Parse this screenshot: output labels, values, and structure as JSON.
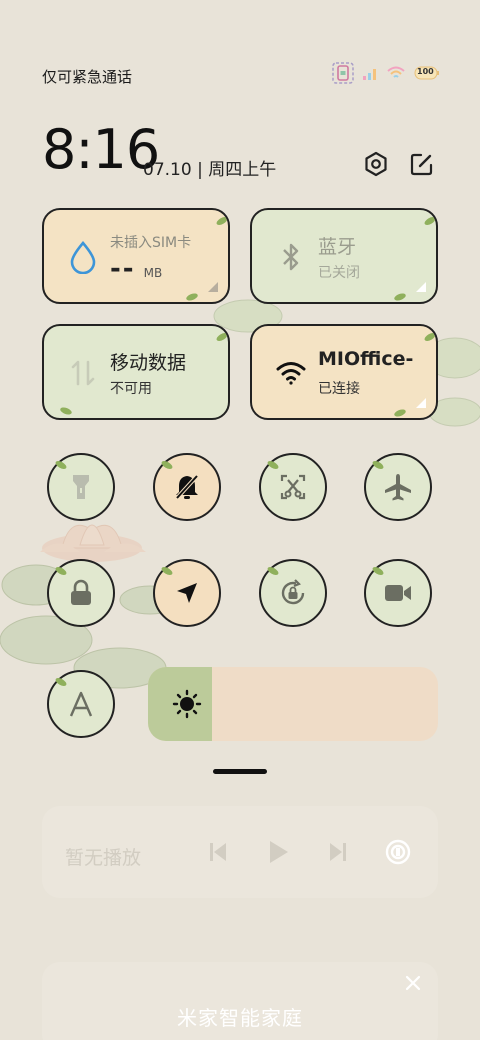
{
  "status_bar": {
    "carrier_text": "仅可紧急通话",
    "battery": "100"
  },
  "header": {
    "time": "8:16",
    "date": "07.10 | 周四上午"
  },
  "tiles": {
    "data_usage": {
      "title": "未插入SIM卡",
      "value": "--",
      "unit": "MB"
    },
    "bluetooth": {
      "title": "蓝牙",
      "status": "已关闭"
    },
    "mobile_data": {
      "title": "移动数据",
      "status": "不可用"
    },
    "wifi": {
      "title": "MIOffice-",
      "status": "已连接"
    }
  },
  "toggles": [
    {
      "name": "flashlight",
      "state": "off"
    },
    {
      "name": "mute",
      "state": "on"
    },
    {
      "name": "screenshot",
      "state": "off"
    },
    {
      "name": "airplane",
      "state": "off"
    },
    {
      "name": "lock",
      "state": "off"
    },
    {
      "name": "location",
      "state": "on"
    },
    {
      "name": "auto-rotate",
      "state": "off"
    },
    {
      "name": "screen-record",
      "state": "off"
    },
    {
      "name": "auto-brightness",
      "state": "off"
    }
  ],
  "brightness": {
    "level": 0.22
  },
  "media": {
    "title": "暂无播放"
  },
  "smart_home": {
    "title": "米家智能家庭"
  },
  "colors": {
    "background": "#e8e3d8",
    "tile_peach": "#f4e3c4",
    "tile_green": "#e1e8cf",
    "slider_fill": "#bccb9a",
    "slider_track": "#efdcc7"
  }
}
